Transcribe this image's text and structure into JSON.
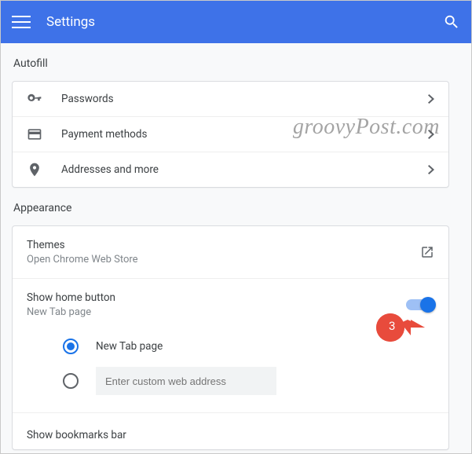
{
  "header": {
    "title": "Settings"
  },
  "watermark": "groovyPost.com",
  "callout": {
    "number": "3"
  },
  "autofill": {
    "section": "Autofill",
    "passwords": "Passwords",
    "payment": "Payment methods",
    "addresses": "Addresses and more"
  },
  "appearance": {
    "section": "Appearance",
    "themes_title": "Themes",
    "themes_sub": "Open Chrome Web Store",
    "home_title": "Show home button",
    "home_sub": "New Tab page",
    "radio_newtab": "New Tab page",
    "radio_custom_placeholder": "Enter custom web address",
    "bookmarks": "Show bookmarks bar"
  }
}
